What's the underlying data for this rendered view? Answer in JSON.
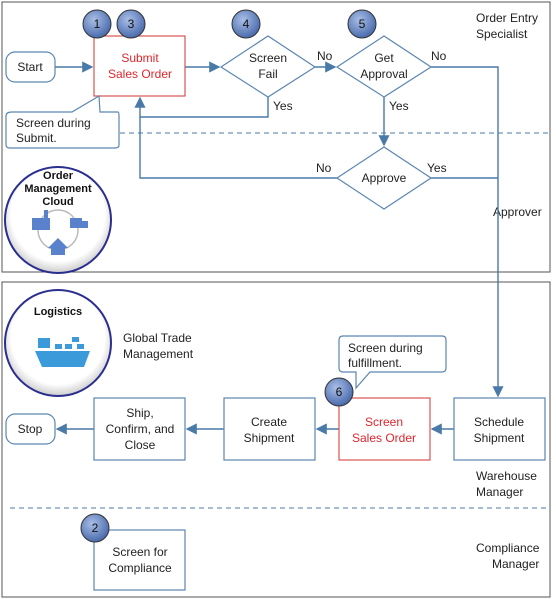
{
  "lanes": {
    "order_entry": [
      "Order Entry",
      "Specialist"
    ],
    "approver": "Approver",
    "warehouse": [
      "Warehouse",
      "Manager"
    ],
    "compliance": [
      "Compliance",
      "Manager"
    ]
  },
  "clouds": {
    "order_management": [
      "Order",
      "Management",
      "Cloud"
    ],
    "logistics": "Logistics",
    "gtm": [
      "Global Trade",
      "Management"
    ]
  },
  "nodes": {
    "start": "Start",
    "submit": [
      "Submit",
      "Sales Order"
    ],
    "screen_fail": [
      "Screen",
      "Fail"
    ],
    "get_approval": [
      "Get",
      "Approval"
    ],
    "approve": "Approve",
    "stop": "Stop",
    "ship": [
      "Ship,",
      "Confirm, and",
      "Close"
    ],
    "create_shipment": [
      "Create",
      "Shipment"
    ],
    "screen_sales_order": [
      "Screen",
      "Sales Order"
    ],
    "schedule_shipment": [
      "Schedule",
      "Shipment"
    ],
    "screen_compliance": [
      "Screen for",
      "Compliance"
    ]
  },
  "callouts": {
    "submit": [
      "Screen during",
      "Submit."
    ],
    "fulfillment": [
      "Screen during",
      "fulfillment."
    ]
  },
  "edge_labels": {
    "no1": "No",
    "yes1": "Yes",
    "no2": "No",
    "yes2": "Yes",
    "no3": "No",
    "yes3": "Yes"
  },
  "badges": [
    "1",
    "3",
    "4",
    "5",
    "6",
    "2"
  ],
  "colors": {
    "line": "#4a7aa8",
    "highlight": "#e0262b",
    "badge": "#5b7fc0"
  }
}
